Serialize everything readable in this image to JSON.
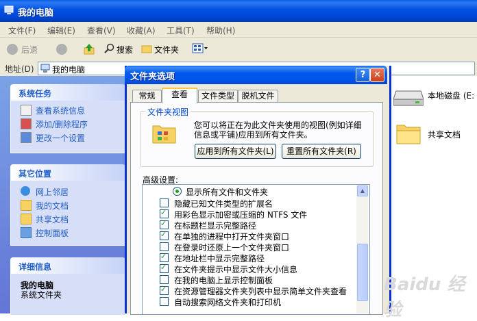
{
  "window": {
    "title": "我的电脑"
  },
  "menu": [
    "文件(F)",
    "编辑(E)",
    "查看(V)",
    "收藏(A)",
    "工具(T)",
    "帮助(H)"
  ],
  "toolbar": {
    "back": "后退",
    "search": "搜索",
    "folders": "文件夹"
  },
  "address": {
    "label": "地址(D)",
    "value": "我的电脑"
  },
  "left": {
    "system_tasks": {
      "title": "系统任务",
      "items": [
        "查看系统信息",
        "添加/删除程序",
        "更改一个设置"
      ]
    },
    "other_places": {
      "title": "其它位置",
      "items": [
        "网上邻居",
        "我的文档",
        "共享文档",
        "控制面板"
      ]
    },
    "details": {
      "title": "详细信息",
      "name": "我的电脑",
      "desc": "系统文件夹"
    }
  },
  "right": {
    "items": [
      "本地磁盘 (E:",
      "共享文档"
    ]
  },
  "dialog": {
    "title": "文件夹选项",
    "help": "?",
    "close": "✕",
    "tabs": [
      "常规",
      "查看",
      "文件类型",
      "脱机文件"
    ],
    "folder_views": {
      "label": "文件夹视图",
      "text": "您可以将正在为此文件夹使用的视图(例如详细信息或平铺)应用到所有文件夹。",
      "apply_all": "应用到所有文件夹(L)",
      "reset_all": "重置所有文件夹(R)"
    },
    "advanced_label": "高级设置:",
    "settings": [
      {
        "label": "显示所有文件和文件夹",
        "type": "radio",
        "checked": true
      },
      {
        "label": "隐藏已知文件类型的扩展名",
        "type": "checkbox",
        "checked": false
      },
      {
        "label": "用彩色显示加密或压缩的 NTFS 文件",
        "type": "checkbox",
        "checked": true
      },
      {
        "label": "在标题栏显示完整路径",
        "type": "checkbox",
        "checked": true
      },
      {
        "label": "在单独的进程中打开文件夹窗口",
        "type": "checkbox",
        "checked": true
      },
      {
        "label": "在登录时还原上一个文件夹窗口",
        "type": "checkbox",
        "checked": false
      },
      {
        "label": "在地址栏中显示完整路径",
        "type": "checkbox",
        "checked": true
      },
      {
        "label": "在文件夹提示中显示文件大小信息",
        "type": "checkbox",
        "checked": true
      },
      {
        "label": "在我的电脑上显示控制面板",
        "type": "checkbox",
        "checked": false
      },
      {
        "label": "在资源管理器文件夹列表中显示简单文件夹查看",
        "type": "checkbox",
        "checked": true
      },
      {
        "label": "自动搜索网络文件夹和打印机",
        "type": "checkbox",
        "checked": false
      }
    ]
  },
  "watermark": "Baidu 经验"
}
